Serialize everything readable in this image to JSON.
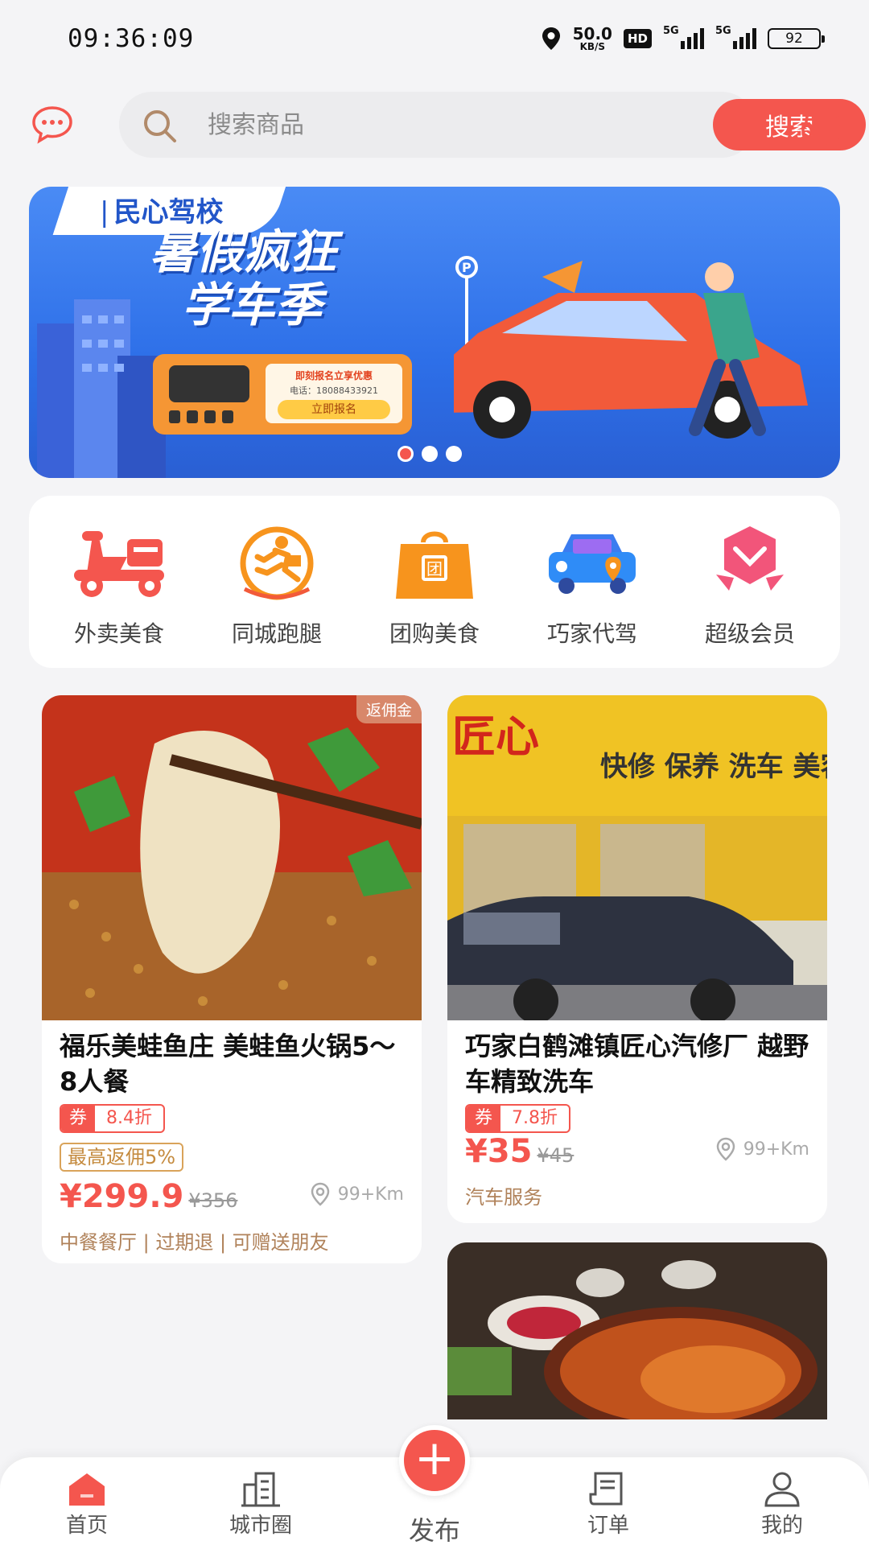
{
  "status_bar": {
    "time": "09:36:09",
    "net_speed": "50.0",
    "net_unit": "KB/S",
    "hd": "HD",
    "sig1": "5G",
    "sig2": "5G",
    "battery": "92"
  },
  "header": {
    "search_placeholder": "搜索商品",
    "search_button": "搜索"
  },
  "banner": {
    "school": "民心驾校",
    "headline_1": "暑假疯狂",
    "headline_2": "学车季",
    "promo": "即刻报名立享优惠",
    "phone": "电话：18088433921",
    "cta": "立即报名",
    "page_count": 3,
    "active_page": 1
  },
  "categories": [
    {
      "label": "外卖美食",
      "icon": "scooter-icon"
    },
    {
      "label": "同城跑腿",
      "icon": "courier-icon"
    },
    {
      "label": "团购美食",
      "icon": "group-bag-icon"
    },
    {
      "label": "巧家代驾",
      "icon": "car-icon"
    },
    {
      "label": "超级会员",
      "icon": "vip-badge-icon"
    }
  ],
  "products": [
    {
      "badge": "返佣金",
      "title": "福乐美蛙鱼庄 美蛙鱼火锅5～8人餐",
      "coupon_label": "券",
      "discount": "8.4折",
      "rebate": "最高返佣5%",
      "price": "¥299.9",
      "original_price": "¥356",
      "distance": "99+Km",
      "meta": "中餐餐厅 | 过期退 | 可赠送朋友"
    },
    {
      "title": "巧家白鹤滩镇匠心汽修厂 越野车精致洗车",
      "coupon_label": "券",
      "discount": "7.8折",
      "price": "¥35",
      "original_price": "¥45",
      "distance": "99+Km",
      "meta": "汽车服务"
    }
  ],
  "tabbar": {
    "home": "首页",
    "city": "城市圈",
    "publish": "发布",
    "orders": "订单",
    "mine": "我的"
  },
  "colors": {
    "accent": "#f4564e",
    "rebate": "#c58b3f"
  }
}
